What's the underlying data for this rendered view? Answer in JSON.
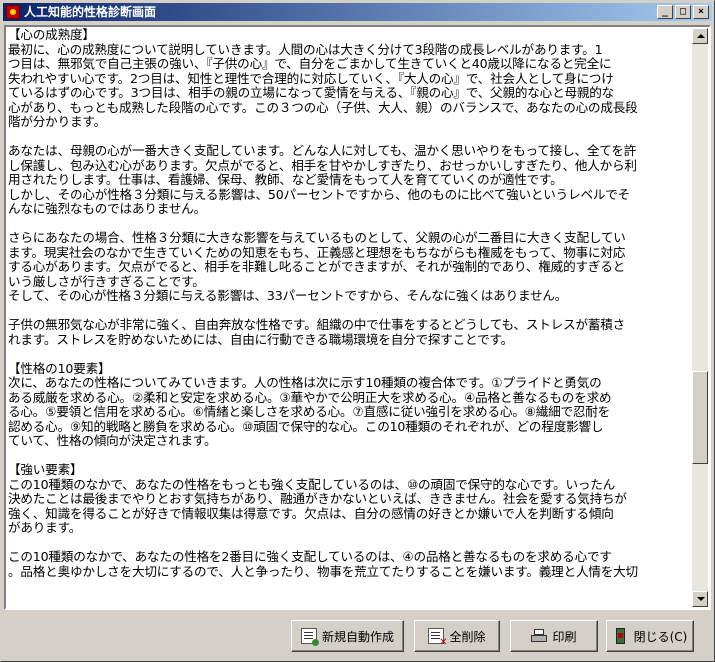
{
  "window": {
    "title": "人工知能的性格診断画面",
    "caption_buttons": {
      "minimize": "_",
      "maximize": "□",
      "close": "×"
    }
  },
  "report": {
    "paragraphs": [
      [
        "【心の成熟度】",
        "最初に、心の成熟度について説明していきます。人間の心は大きく分けて3段階の成長レベルがあります。1",
        "つ目は、無邪気で自己主張の強い、『子供の心』で、自分をごまかして生きていくと40歳以降になると完全に",
        "失われやすい心です。2つ目は、知性と理性で合理的に対応していく、『大人の心』で、社会人として身につけ",
        "ているはずの心です。3つ目は、相手の親の立場になって愛情を与える、『親の心』で、父親的な心と母親的な",
        "心があり、もっとも成熟した段階の心です。この３つの心（子供、大人、親）のバランスで、あなたの心の成長段",
        "階が分かります。"
      ],
      [
        "あなたは、母親の心が一番大きく支配しています。どんな人に対しても、温かく思いやりをもって接し、全てを許",
        "し保護し、包み込む心があります。欠点がでると、相手を甘やかしすぎたり、おせっかいしすぎたり、他人から利",
        "用されたりします。仕事は、看護婦、保母、教師、など愛情をもって人を育てていくのが適性です。",
        "しかし、その心が性格３分類に与える影響は、50パーセントですから、他のものに比べて強いというレベルでそ",
        "んなに強烈なものではありません。"
      ],
      [
        "さらにあなたの場合、性格３分類に大きな影響を与えているものとして、父親の心が二番目に大きく支配してい",
        "ます。現実社会のなかで生きていくための知恵をもち、正義感と理想をもちながらも権威をもって、物事に対応",
        "する心があります。欠点がでると、相手を非難し叱ることができますが、それが強制的であり、権威的すぎると",
        "いう厳しさが行きすぎることです。",
        "そして、その心が性格３分類に与える影響は、33パーセントですから、そんなに強くはありません。"
      ],
      [
        "子供の無邪気な心が非常に強く、自由奔放な性格です。組織の中で仕事をするとどうしても、ストレスが蓄積さ",
        "れます。ストレスを貯めないためには、自由に行動できる職場環境を自分で探すことです。"
      ],
      [
        "【性格の10要素】",
        "次に、あなたの性格についてみていきます。人の性格は次に示す10種類の複合体です。①プライドと勇気の",
        "ある威厳を求める心。②柔和と安定を求める心。③華やかで公明正大を求める心。④品格と善なるものを求め",
        "る心。⑤要領と信用を求める心。⑥情緒と楽しさを求める心。⑦直感に従い強引を求める心。⑧繊細で忍耐を",
        "認める心。⑨知的戦略と勝負を求める心。⑩頑固で保守的な心。この10種類のそれぞれが、どの程度影響し",
        "ていて、性格の傾向が決定されます。"
      ],
      [
        "【強い要素】",
        "この10種類のなかで、あなたの性格をもっとも強く支配しているのは、⑩の頑固で保守的な心です。いったん",
        "決めたことは最後までやりとおす気持ちがあり、融通がきかないといえば、ききません。社会を愛する気持ちが",
        "強く、知識を得ることが好きで情報収集は得意です。欠点は、自分の感情の好きとか嫌いで人を判断する傾向",
        "があります。"
      ],
      [
        "この10種類のなかで、あなたの性格を2番目に強く支配しているのは、④の品格と善なるものを求める心です",
        "。品格と奥ゆかしさを大切にするので、人と争ったり、物事を荒立てたりすることを嫌います。義理と人情を大切"
      ]
    ]
  },
  "toolbar": {
    "new_auto_create": "新規自動作成",
    "delete_all": "全削除",
    "print": "印刷",
    "close": "閉じる(C)"
  },
  "scrollbar": {
    "position": 0.72,
    "visible_fraction": 0.17
  }
}
